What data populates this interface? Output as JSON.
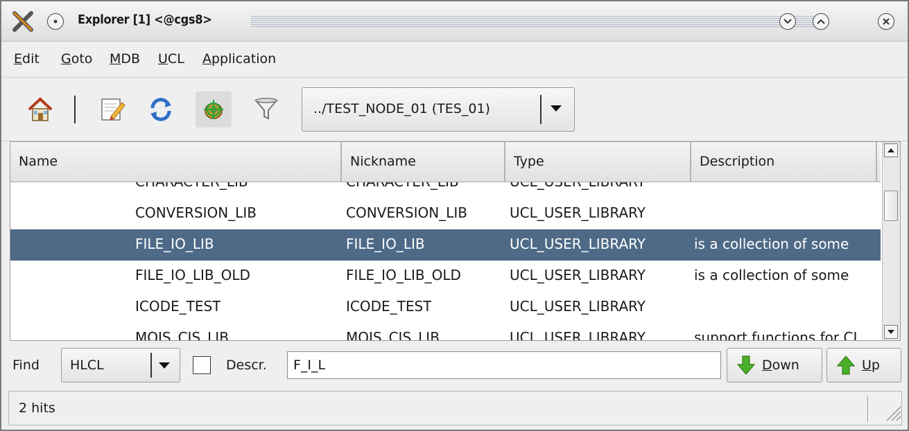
{
  "window": {
    "title": "Explorer [1] <@cgs8>"
  },
  "menubar": {
    "items": [
      {
        "label": "Edit",
        "mnemonic": "E",
        "rest": "dit"
      },
      {
        "label": "Goto",
        "mnemonic": "G",
        "rest": "oto"
      },
      {
        "label": "MDB",
        "mnemonic": "M",
        "rest": "DB"
      },
      {
        "label": "UCL",
        "mnemonic": "U",
        "rest": "CL"
      },
      {
        "label": "Application",
        "mnemonic": "A",
        "rest": "pplication"
      }
    ]
  },
  "toolbar": {
    "icons": [
      "home-icon",
      "edit-icon",
      "refresh-icon",
      "target-bug-icon",
      "filter-icon"
    ],
    "node_select": "../TEST_NODE_01 (TES_01)"
  },
  "table": {
    "columns": [
      "Name",
      "Nickname",
      "Type",
      "Description"
    ],
    "rows": [
      {
        "name": "CHARACTER_LIB",
        "nickname": "CHARACTER_LIB",
        "type": "UCL_USER_LIBRARY",
        "description": "",
        "selected": false
      },
      {
        "name": "CONVERSION_LIB",
        "nickname": "CONVERSION_LIB",
        "type": "UCL_USER_LIBRARY",
        "description": "",
        "selected": false
      },
      {
        "name": "FILE_IO_LIB",
        "nickname": "FILE_IO_LIB",
        "type": "UCL_USER_LIBRARY",
        "description": "is a collection of some",
        "selected": true
      },
      {
        "name": "FILE_IO_LIB_OLD",
        "nickname": "FILE_IO_LIB_OLD",
        "type": "UCL_USER_LIBRARY",
        "description": "is a collection of some",
        "selected": false
      },
      {
        "name": "ICODE_TEST",
        "nickname": "ICODE_TEST",
        "type": "UCL_USER_LIBRARY",
        "description": "",
        "selected": false
      },
      {
        "name": "MOIS_CIS_LIB",
        "nickname": "MOIS_CIS_LIB",
        "type": "UCL_USER_LIBRARY",
        "description": "support functions for CI",
        "selected": false
      }
    ]
  },
  "find": {
    "label": "Find",
    "mode": "HLCL",
    "descr_checked": false,
    "descr_label": "Descr.",
    "query": "F_I_L",
    "down": {
      "label": "Down",
      "mnemonic": "D",
      "rest": "own"
    },
    "up": {
      "label": "Up",
      "mnemonic": "U",
      "rest": "p"
    }
  },
  "status": {
    "text": "2 hits"
  },
  "colors": {
    "selection": "#4e6a87",
    "arrow_green": "#4caf2a"
  }
}
